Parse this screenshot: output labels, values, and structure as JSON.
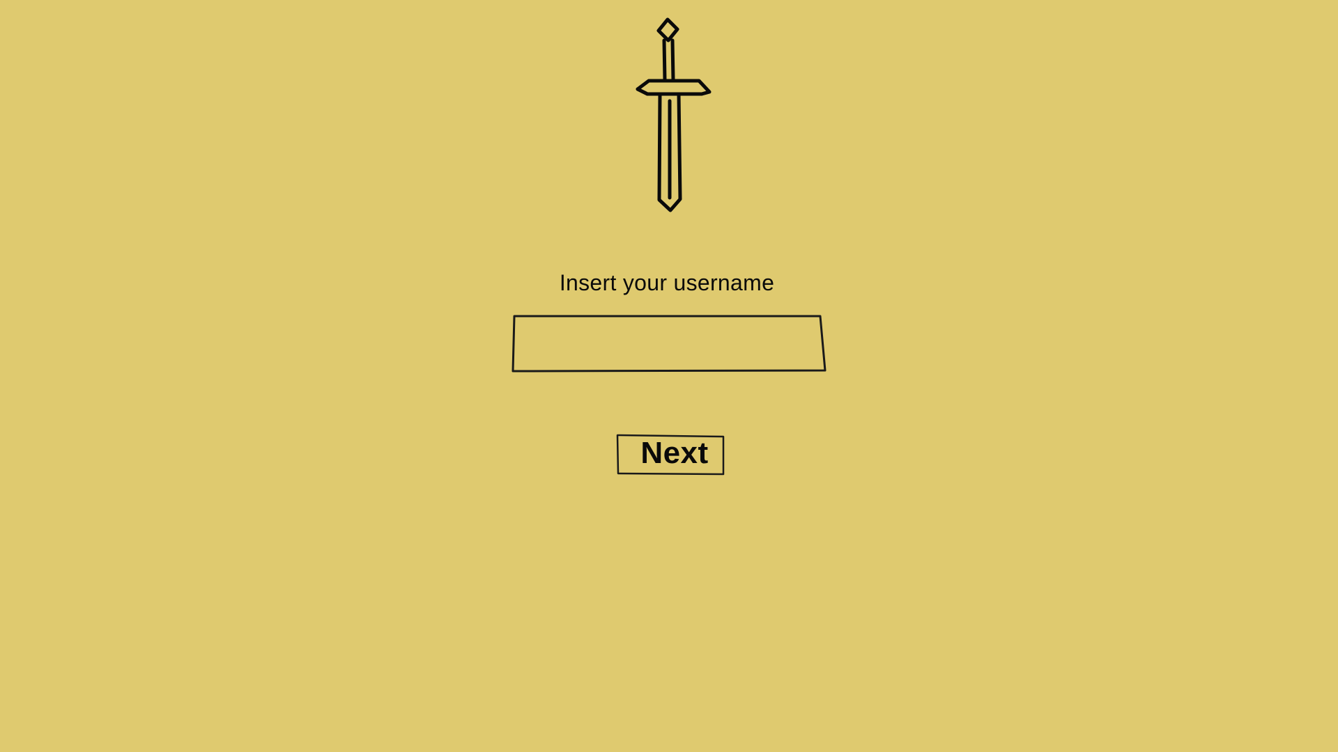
{
  "theme": {
    "background": "#dfca6f",
    "ink": "#0a0a0a"
  },
  "logo": {
    "icon": "sword-icon"
  },
  "form": {
    "prompt": "Insert your username",
    "username_value": "",
    "next_label": "Next"
  }
}
